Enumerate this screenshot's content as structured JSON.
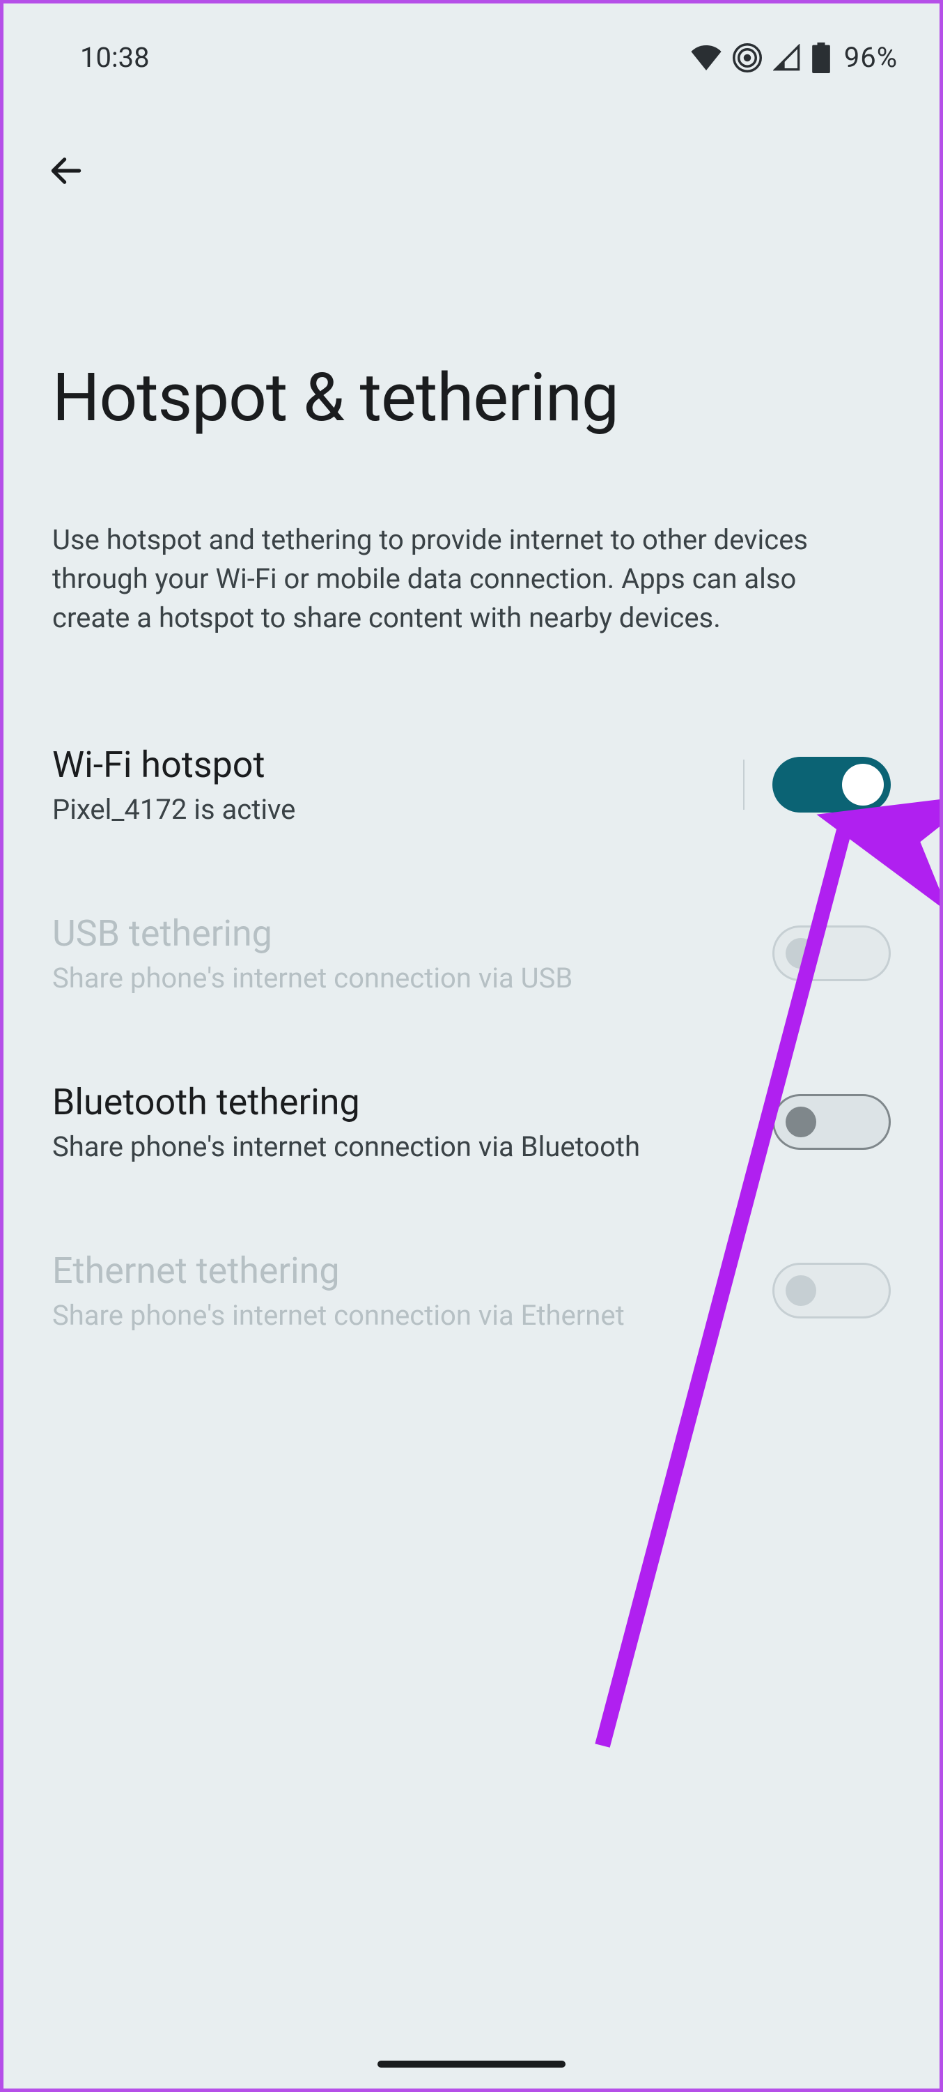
{
  "statusbar": {
    "time": "10:38",
    "battery_text": "96%"
  },
  "page": {
    "title": "Hotspot & tethering",
    "description": "Use hotspot and tethering to provide internet to other devices through your Wi-Fi or mobile data connection. Apps can also create a hotspot to share content with nearby devices."
  },
  "settings": {
    "wifi_hotspot": {
      "title": "Wi-Fi hotspot",
      "subtitle": "Pixel_4172 is active"
    },
    "usb_tethering": {
      "title": "USB tethering",
      "subtitle": "Share phone's internet connection via USB"
    },
    "bluetooth_tethering": {
      "title": "Bluetooth tethering",
      "subtitle": "Share phone's internet connection via Bluetooth"
    },
    "ethernet_tethering": {
      "title": "Ethernet tethering",
      "subtitle": "Share phone's internet connection via Ethernet"
    }
  }
}
